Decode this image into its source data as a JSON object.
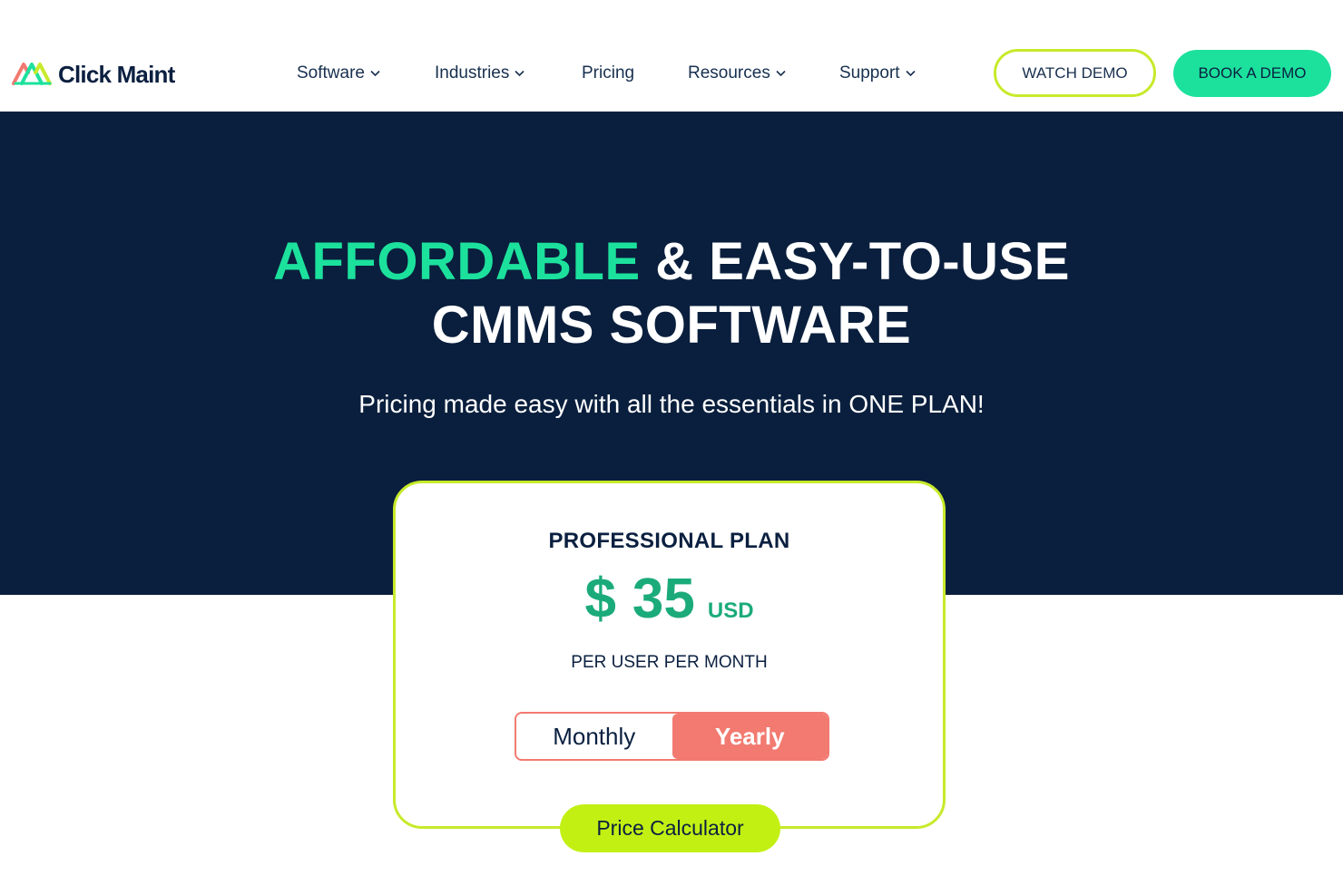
{
  "brand": {
    "name": "Click Maint",
    "logo_icon": "click-maint-logo-icon",
    "colors": {
      "navy": "#0a1f3d",
      "green": "#1ce19d",
      "lime": "#c7ea2a",
      "coral": "#f27a70",
      "price_green": "#1bab7a"
    }
  },
  "nav": {
    "items": [
      {
        "label": "Software",
        "dropdown": true
      },
      {
        "label": "Industries",
        "dropdown": true
      },
      {
        "label": "Pricing",
        "dropdown": false
      },
      {
        "label": "Resources",
        "dropdown": true
      },
      {
        "label": "Support",
        "dropdown": true
      }
    ],
    "watch_demo": "WATCH DEMO",
    "book_demo": "BOOK A DEMO"
  },
  "hero": {
    "headline_accent": "AFFORDABLE",
    "headline_rest": "& EASY-TO-USE",
    "headline_line2": "CMMS SOFTWARE",
    "subtitle": "Pricing made easy with all the essentials in ONE PLAN!"
  },
  "plan": {
    "name": "PROFESSIONAL PLAN",
    "currency_symbol": "$",
    "price": "35",
    "currency": "USD",
    "period": "PER USER PER MONTH",
    "billing_options": [
      "Monthly",
      "Yearly"
    ],
    "selected_billing": "Yearly",
    "calculator_label": "Price Calculator"
  }
}
